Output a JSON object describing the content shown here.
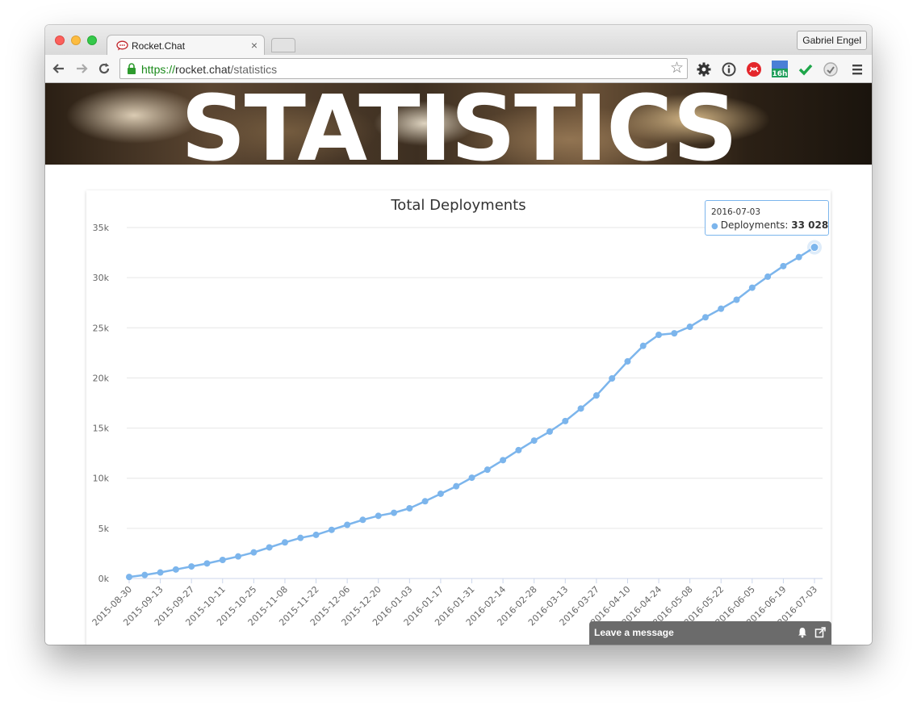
{
  "browser": {
    "tab_title": "Rocket.Chat",
    "tab_close": "×",
    "profile_name": "Gabriel Engel",
    "url_scheme": "https://",
    "url_host": "rocket.chat",
    "url_path": "/statistics",
    "star_glyph": "☆",
    "extensions": [
      "gear-icon",
      "info-icon",
      "acrobat-icon",
      "calendar-icon",
      "checkmark-icon",
      "gauge-icon",
      "menu-icon"
    ],
    "calendar_badge": "16h"
  },
  "page": {
    "banner_title": "STATISTICS",
    "accent_color": "#7cb5ec"
  },
  "tooltip": {
    "date": "2016-07-03",
    "label": "Deployments: ",
    "value": "33 028"
  },
  "livechat": {
    "label": "Leave a message"
  },
  "chart_data": {
    "type": "line",
    "title": "Total Deployments",
    "xlabel": "",
    "ylabel": "",
    "ylim": [
      0,
      35000
    ],
    "yticks": [
      "0k",
      "5k",
      "10k",
      "15k",
      "20k",
      "25k",
      "30k",
      "35k"
    ],
    "grid": true,
    "x_tick_labels": [
      "2015-08-30",
      "2015-09-13",
      "2015-09-27",
      "2015-10-11",
      "2015-10-25",
      "2015-11-08",
      "2015-11-22",
      "2015-12-06",
      "2015-12-20",
      "2016-01-03",
      "2016-01-17",
      "2016-01-31",
      "2016-02-14",
      "2016-02-28",
      "2016-03-13",
      "2016-03-27",
      "2016-04-10",
      "2016-04-24",
      "2016-05-08",
      "2016-05-22",
      "2016-06-05",
      "2016-06-19",
      "2016-07-03"
    ],
    "series": [
      {
        "name": "Deployments",
        "color": "#7cb5ec",
        "values": [
          150,
          350,
          600,
          900,
          1200,
          1500,
          1850,
          2200,
          2600,
          3100,
          3600,
          4050,
          4350,
          4850,
          5350,
          5850,
          6250,
          6550,
          7000,
          7700,
          8450,
          9200,
          10050,
          10850,
          11800,
          12800,
          13750,
          14650,
          15700,
          16950,
          18250,
          19950,
          21650,
          23200,
          24300,
          24450,
          25100,
          26050,
          26900,
          27800,
          29000,
          30100,
          31150,
          32050,
          33028
        ]
      }
    ]
  }
}
